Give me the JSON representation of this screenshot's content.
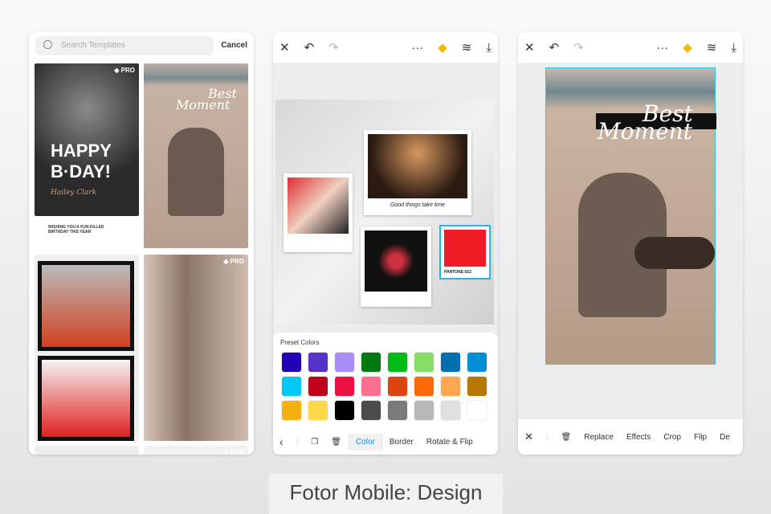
{
  "panel1": {
    "search_placeholder": "Search Templates",
    "cancel": "Cancel",
    "pro": "◆ PRO",
    "template1": {
      "headline1": "HAPPY",
      "headline2": "B·DAY!",
      "name": "Hailey Clark",
      "sub": "WISHING YOU A FUN-FILLED BIRTHDAY THIS YEAR"
    },
    "template2": {
      "title1": "Best",
      "title2": "Moment"
    }
  },
  "panel2": {
    "polaroid_caption": "Good things take time",
    "pantone": "PANTONE-022",
    "preset_title": "Preset Colors",
    "colors": [
      "#2200b8",
      "#5533c8",
      "#a88ef5",
      "#007a10",
      "#00bb18",
      "#88dd66",
      "#0070b0",
      "#0090d8",
      "#00c8f5",
      "#c0001a",
      "#ee1040",
      "#ff7090",
      "#dd4410",
      "#ff6a08",
      "#ffa850",
      "#b87800",
      "#f8b010",
      "#ffd84a",
      "#000000",
      "#4c4c4c",
      "#7a7a7a",
      "#b8b8b8",
      "#e0e0e0",
      "#ffffff"
    ],
    "toolbar": {
      "color": "Color",
      "border": "Border",
      "rotate": "Rotate & Flip"
    }
  },
  "panel3": {
    "title1": "Best",
    "title2": "Moment",
    "toolbar": {
      "replace": "Replace",
      "effects": "Effects",
      "crop": "Crop",
      "flip": "Flip",
      "more": "De"
    }
  },
  "caption": "Fotor Mobile: Design"
}
